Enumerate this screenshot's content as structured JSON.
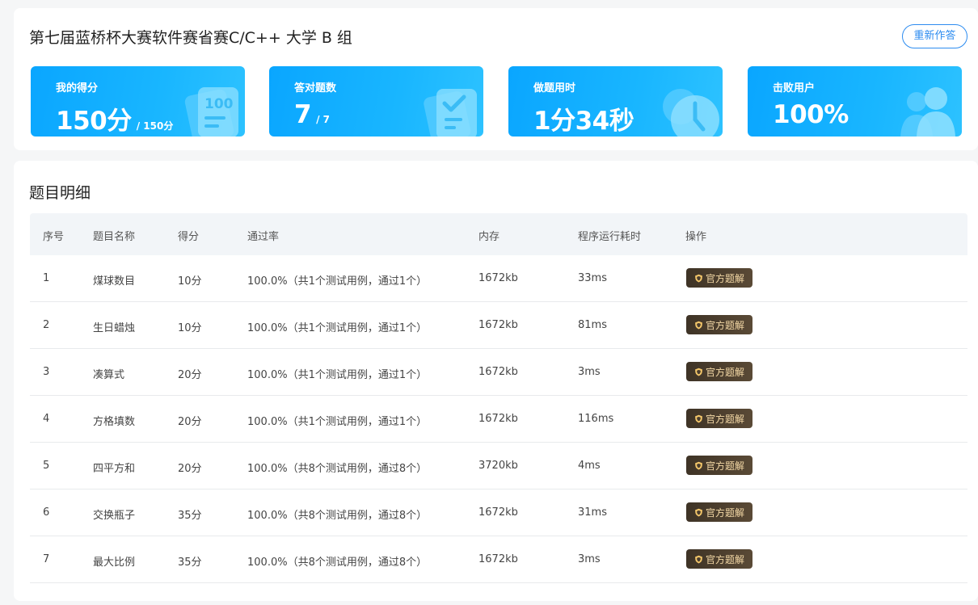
{
  "header": {
    "title": "第七届蓝桥杯大赛软件赛省赛C/C++ 大学 B 组",
    "redo_label": "重新作答"
  },
  "stats": [
    {
      "label": "我的得分",
      "value": "150分",
      "sub": "/ 150分",
      "icon": "score-100-icon"
    },
    {
      "label": "答对题数",
      "value": "7",
      "sub": "/ 7",
      "icon": "checklist-icon"
    },
    {
      "label": "做题用时",
      "value": "1分34秒",
      "sub": "",
      "icon": "clock-icon"
    },
    {
      "label": "击败用户",
      "value": "100%",
      "sub": "",
      "icon": "users-icon"
    }
  ],
  "colors": {
    "accent": "#2d8cf0",
    "stat_gradient_start": "#0aa6ff",
    "stat_gradient_end": "#2dc2ff",
    "solution_button_bg": "#4a3d2e",
    "solution_button_text": "#f4d9a6"
  },
  "details": {
    "title": "题目明细",
    "columns": [
      "序号",
      "题目名称",
      "得分",
      "通过率",
      "内存",
      "程序运行耗时",
      "操作"
    ],
    "rows": [
      {
        "no": "1",
        "name": "煤球数目",
        "score": "10分",
        "pass": "100.0%（共1个测试用例，通过1个）",
        "mem": "1672kb",
        "time": "33ms"
      },
      {
        "no": "2",
        "name": "生日蜡烛",
        "score": "10分",
        "pass": "100.0%（共1个测试用例，通过1个）",
        "mem": "1672kb",
        "time": "81ms"
      },
      {
        "no": "3",
        "name": "凑算式",
        "score": "20分",
        "pass": "100.0%（共1个测试用例，通过1个）",
        "mem": "1672kb",
        "time": "3ms"
      },
      {
        "no": "4",
        "name": "方格填数",
        "score": "20分",
        "pass": "100.0%（共1个测试用例，通过1个）",
        "mem": "1672kb",
        "time": "116ms"
      },
      {
        "no": "5",
        "name": "四平方和",
        "score": "20分",
        "pass": "100.0%（共8个测试用例，通过8个）",
        "mem": "3720kb",
        "time": "4ms"
      },
      {
        "no": "6",
        "name": "交换瓶子",
        "score": "35分",
        "pass": "100.0%（共8个测试用例，通过8个）",
        "mem": "1672kb",
        "time": "31ms"
      },
      {
        "no": "7",
        "name": "最大比例",
        "score": "35分",
        "pass": "100.0%（共8个测试用例，通过8个）",
        "mem": "1672kb",
        "time": "3ms"
      }
    ],
    "solution_label": "官方题解",
    "solution_icon": "shield-icon"
  }
}
